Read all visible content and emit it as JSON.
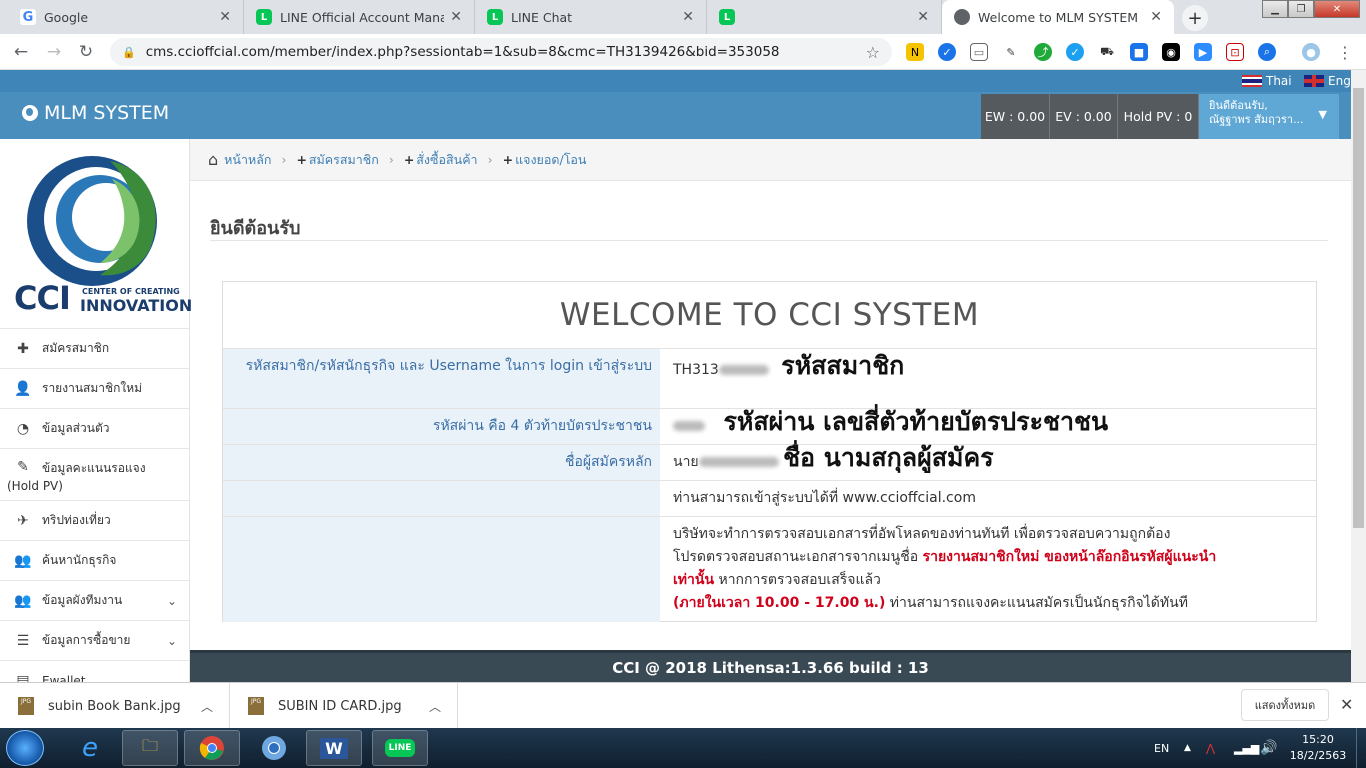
{
  "browser": {
    "tabs": [
      {
        "title": "Google",
        "icon": "google-icon"
      },
      {
        "title": "LINE Official Account Manager",
        "icon": "line-icon"
      },
      {
        "title": "LINE Chat",
        "icon": "line-icon"
      },
      {
        "title": "",
        "icon": "line-icon"
      },
      {
        "title": "Welcome to MLM SYSTEM",
        "icon": "globe-icon"
      }
    ],
    "url": "cms.ccioffcial.com/member/index.php?sessiontab=1&sub=8&cmc=TH3139426&bid=353058"
  },
  "langs": {
    "thai": "Thai",
    "eng": "Eng"
  },
  "header": {
    "brand": "MLM SYSTEM",
    "ew": "EW : 0.00",
    "ev": "EV : 0.00",
    "holdpv": "Hold PV : 0",
    "user_greeting": "ยินดีต้อนรับ,",
    "user_name": "ณัฐฐาพร สัมฤวรา..."
  },
  "logo": {
    "line1": "CCI",
    "line2": "CENTER OF CREATING",
    "line3": "INNOVATION"
  },
  "sidebar": {
    "items": [
      {
        "label": "สมัครสมาชิก",
        "icon": "plus-icon"
      },
      {
        "label": "รายงานสมาชิกใหม่",
        "icon": "user-icon"
      },
      {
        "label": "ข้อมูลส่วนตัว",
        "icon": "dashboard-icon"
      },
      {
        "label": "ข้อมูลคะแนนรอแจง",
        "sub": "(Hold PV)",
        "icon": "edit-icon"
      },
      {
        "label": "ทริปท่องเที่ยว",
        "icon": "plane-icon"
      },
      {
        "label": "ค้นหานักธุรกิจ",
        "icon": "users-icon"
      },
      {
        "label": "ข้อมูลผังทีมงาน",
        "icon": "users-icon"
      },
      {
        "label": "ข้อมูลการซื้อขาย",
        "icon": "list-icon"
      },
      {
        "label": "Ewallet",
        "icon": "wallet-icon"
      }
    ]
  },
  "breadcrumb": {
    "home": "หน้าหลัก",
    "b1": "สมัครสมาชิก",
    "b2": "สั่งซื้อสินค้า",
    "b3": "แจงยอด/โอน"
  },
  "page": {
    "title": "ยินดีต้อนรับ"
  },
  "panel": {
    "welcome": "WELCOME TO CCI SYSTEM",
    "row1_label": "รหัสสมาชิก/รหัสนักธุรกิจ และ Username ในการ login เข้าสู่ระบบ",
    "row1_value": "TH313",
    "row1_note": "รหัสสมาชิก",
    "row2_label": "รหัสผ่าน คือ 4 ตัวท้ายบัตรประชาชน",
    "row2_note": "รหัสผ่าน เลขสี่ตัวท้ายบัตรประชาชน",
    "row3_label": "ชื่อผู้สมัครหลัก",
    "row3_value": "นาย",
    "row3_note": "ชื่อ นามสกุลผู้สมัคร",
    "row4_value": "ท่านสามารถเข้าสู่ระบบได้ที่ www.ccioffcial.com",
    "row5_line1": "บริษัทจะทำการตรวจสอบเอกสารที่อัพโหลดของท่านทันที เพื่อตรวจสอบความถูกต้อง",
    "row5_line2a": "โปรดตรวจสอบสถานะเอกสารจากเมนูชื่อ ",
    "row5_line2b": "รายงานสมาชิกใหม่ ของหน้าล๊อกอินรหัสผู้แนะนำ",
    "row5_line3a": "เท่านั้น",
    "row5_line3b": " หากการตรวจสอบเสร็จแล้ว",
    "row5_line4a": "(ภายในเวลา 10.00 - 17.00 น.)",
    "row5_line4b": " ท่านสามารถแจงคะแนนสมัครเป็นนักธุรกิจได้ทันที"
  },
  "footer": {
    "text": "CCI @ 2018 Lithensa:1.3.66 build : 13"
  },
  "downloads": {
    "items": [
      {
        "name": "subin Book Bank.jpg"
      },
      {
        "name": "SUBIN ID CARD.jpg"
      }
    ],
    "show_all": "แสดงทั้งหมด"
  },
  "taskbar": {
    "lang": "EN",
    "time": "15:20",
    "date": "18/2/2563"
  }
}
